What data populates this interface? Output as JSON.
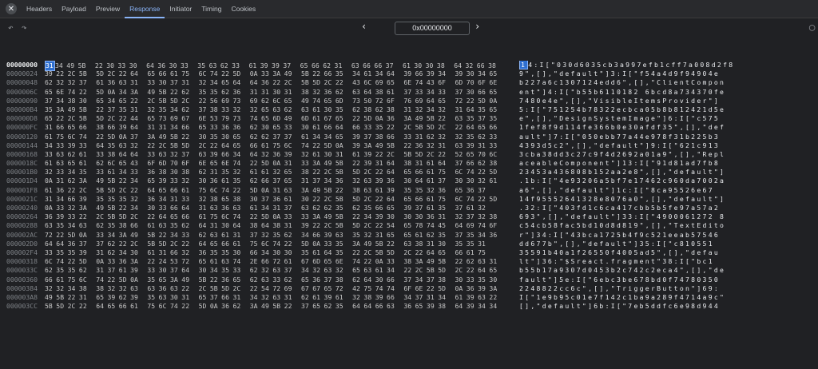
{
  "tabs": [
    {
      "label": "Headers",
      "active": false
    },
    {
      "label": "Payload",
      "active": false
    },
    {
      "label": "Preview",
      "active": false
    },
    {
      "label": "Response",
      "active": true
    },
    {
      "label": "Initiator",
      "active": false
    },
    {
      "label": "Timing",
      "active": false
    },
    {
      "label": "Cookies",
      "active": false
    }
  ],
  "toolbar": {
    "offset_value": "0x00000000"
  },
  "icons": {
    "close": "close-icon",
    "undo": "undo-icon",
    "redo": "redo-icon",
    "prev": "chevron-left-icon",
    "next": "chevron-right-icon",
    "search": "search-icon"
  },
  "colors": {
    "selection": "#2f6fcf",
    "active_tab": "#8ab4f8"
  },
  "rows": [
    {
      "offset": "00000000",
      "hex": "31 34 49 5B 22 30 33 30 64 36 30 33 35 63 62 33 61 39 39 37 65 66 62 31 63 66 66 37 61 30 30 38 64 32 66 38",
      "ascii": "14:I[\"030d6035cb3a997efb1cff7a008d2f8"
    },
    {
      "offset": "00000024",
      "hex": "39 22 2C 5B 5D 2C 22 64 65 66 61 75 6C 74 22 5D 0A 33 3A 49 5B 22 66 35 34 61 34 64 39 66 39 34 39 30 34 65",
      "ascii": "9\",[],\"default\"]3:I[\"f54a4d9f94904e"
    },
    {
      "offset": "00000048",
      "hex": "62 32 32 37 61 36 63 31 33 30 37 31 32 34 65 64 64 36 22 2C 5B 5D 2C 22 43 6C 69 65 6E 74 43 6F 6D 70 6F 6E",
      "ascii": "b227a6c1307124edd6\",[],\"ClientCompon"
    },
    {
      "offset": "0000006C",
      "hex": "65 6E 74 22 5D 0A 34 3A 49 5B 22 62 35 35 62 36 31 31 30 31 38 32 36 62 63 64 38 61 37 33 34 33 37 30 66 65",
      "ascii": "ent\"]4:I[\"b55b6110182 6bcd8a734370fe"
    },
    {
      "offset": "00000090",
      "hex": "37 34 38 30 65 34 65 22 2C 5B 5D 2C 22 56 69 73 69 62 6C 65 49 74 65 6D 73 50 72 6F 76 69 64 65 72 22 5D 0A",
      "ascii": "7480e4e\",[],\"VisibleItemsProvider\"]"
    },
    {
      "offset": "000000B4",
      "hex": "35 3A 49 5B 22 37 35 31 32 35 34 62 37 38 33 32 32 65 63 62 63 61 30 35 62 38 62 38 31 32 34 32 31 64 35 65",
      "ascii": "5:I[\"751254b78322ecbca05b8b812421d5e"
    },
    {
      "offset": "000000D8",
      "hex": "65 22 2C 5B 5D 2C 22 44 65 73 69 67 6E 53 79 73 74 65 6D 49 6D 61 67 65 22 5D 0A 36 3A 49 5B 22 63 35 37 35",
      "ascii": "e\",[],\"DesignSystemImage\"]6:I[\"c575"
    },
    {
      "offset": "000000FC",
      "hex": "31 66 65 66 38 66 39 64 31 31 34 66 65 33 36 36 62 30 65 33 30 61 66 64 66 33 35 22 2C 5B 5D 2C 22 64 65 66",
      "ascii": "1fef8f9d114fe366b0e30afdf35\",[],\"def"
    },
    {
      "offset": "00000120",
      "hex": "61 75 6C 74 22 5D 0A 37 3A 49 5B 22 30 35 30 65 62 62 37 37 61 34 34 65 39 37 38 66 33 31 62 32 32 35 62 33",
      "ascii": "ault\"]7:I[\"050ebb77a44e978f31b225b3"
    },
    {
      "offset": "00000144",
      "hex": "34 33 39 33 64 35 63 32 22 2C 5B 5D 2C 22 64 65 66 61 75 6C 74 22 5D 0A 39 3A 49 5B 22 36 32 31 63 39 31 33",
      "ascii": "4393d5c2\",[],\"default\"]9:I[\"621c913"
    },
    {
      "offset": "00000168",
      "hex": "33 63 62 61 33 38 64 64 33 63 32 37 63 39 66 34 64 32 36 39 32 61 30 31 61 39 22 2C 5B 5D 2C 22 52 65 70 6C",
      "ascii": "3cba38dd3c27c9f4d2692a01a9\",[],\"Repl"
    },
    {
      "offset": "0000018C",
      "hex": "61 63 65 61 62 6C 65 43 6F 6D 70 6F 6E 65 6E 74 22 5D 0A 31 33 3A 49 5B 22 39 31 64 38 31 61 64 37 66 62 38",
      "ascii": "aceableComponent\"]13:I[\"91d81ad7fb8"
    },
    {
      "offset": "000001B0",
      "hex": "32 33 34 35 33 61 34 33 36 38 30 38 62 31 35 32 61 61 32 65 38 22 2C 5B 5D 2C 22 64 65 66 61 75 6C 74 22 5D",
      "ascii": "23453a436808b152aa2e8\",[],\"default\"]"
    },
    {
      "offset": "000001D4",
      "hex": "0A 31 62 3A 49 5B 22 34 65 39 33 32 30 36 61 35 62 66 37 65 31 37 34 36 32 63 39 36 30 64 61 37 30 30 32 61",
      "ascii": ".1b:I[\"4e93206a5bf7e17462c960da7002a"
    },
    {
      "offset": "000001F8",
      "hex": "61 36 22 2C 5B 5D 2C 22 64 65 66 61 75 6C 74 22 5D 0A 31 63 3A 49 5B 22 38 63 61 39 35 35 32 36 65 36 37",
      "ascii": "a6\",[],\"default\"]1c:I[\"8ca95526e67"
    },
    {
      "offset": "0000021C",
      "hex": "31 34 66 39 35 35 35 32 36 34 31 33 32 38 65 38 30 37 36 61 30 22 2C 5B 5D 2C 22 64 65 66 61 75 6C 74 22 5D",
      "ascii": "14f95552641328e8076a0\",[],\"default\"]"
    },
    {
      "offset": "00000240",
      "hex": "0A 33 32 3A 49 5B 22 34 30 33 66 64 31 63 36 63 61 34 31 37 63 62 62 35 62 35 66 65 39 37 61 35 37 61 32",
      "ascii": ".32:I[\"403fd1c6ca417cbb5b5fe97a57a2"
    },
    {
      "offset": "00000264",
      "hex": "36 39 33 22 2C 5B 5D 2C 22 64 65 66 61 75 6C 74 22 5D 0A 33 33 3A 49 5B 22 34 39 30 30 30 36 31 32 37 32 38",
      "ascii": "693\",[],\"default\"]33:I[\"4900061272 8"
    },
    {
      "offset": "00000288",
      "hex": "63 35 34 63 62 35 38 66 61 63 35 62 64 31 30 64 38 64 38 31 39 22 2C 5B 5D 2C 22 54 65 78 74 45 64 69 74 6F",
      "ascii": "c54cb58fac5bd10d8d819\",[],\"TextEdito"
    },
    {
      "offset": "000002AC",
      "hex": "72 22 5D 0A 33 34 3A 49 5B 22 34 33 62 63 61 31 37 32 35 62 34 66 39 63 35 32 31 65 65 61 62 35 37 35 34 36",
      "ascii": "r\"]34:I[\"43bca1725b4f9c521eeab57546"
    },
    {
      "offset": "000002D0",
      "hex": "64 64 36 37 37 62 22 2C 5B 5D 2C 22 64 65 66 61 75 6C 74 22 5D 0A 33 35 3A 49 5B 22 63 38 31 30 35 35 31",
      "ascii": "dd677b\",[],\"default\"]35:I[\"c810551"
    },
    {
      "offset": "000002F4",
      "hex": "33 35 35 39 31 62 34 30 61 31 66 32 36 35 35 30 66 34 30 30 35 61 64 35 22 2C 5B 5D 2C 22 64 65 66 61 75",
      "ascii": "35591b40a1f26550f4005ad5\",[],\"defau"
    },
    {
      "offset": "00000318",
      "hex": "6C 74 22 5D 0A 33 36 3A 22 24 53 72 65 61 63 74 2E 66 72 61 67 6D 65 6E 74 22 0A 33 38 3A 49 5B 22 62 63 31",
      "ascii": "lt\"]36:\"$Sreact.fragment\"38:I[\"bc1"
    },
    {
      "offset": "0000033C",
      "hex": "62 35 35 62 31 37 61 39 33 30 37 64 30 34 35 33 62 32 63 37 34 32 63 32 65 63 61 34 22 2C 5B 5D 2C 22 64 65",
      "ascii": "b55b17a9307d0453b2c742c2eca4\",[],\"de"
    },
    {
      "offset": "00000360",
      "hex": "66 61 75 6C 74 22 5D 0A 35 65 3A 49 5B 22 36 65 62 63 33 62 65 36 37 38 62 64 30 66 37 34 37 38 30 33 35 30",
      "ascii": "fault\"]5e:I[\"6ebc3be678bd0f74780350"
    },
    {
      "offset": "00000384",
      "hex": "32 32 34 38 38 32 32 63 63 36 63 22 2C 5B 5D 2C 22 54 72 69 67 67 65 72 42 75 74 74 6F 6E 22 5D 0A 36 39 3A",
      "ascii": "2248822cc6c\",[],\"TriggerButton\"]69:"
    },
    {
      "offset": "000003A8",
      "hex": "49 5B 22 31 65 39 62 39 35 63 30 31 65 37 66 31 34 32 63 31 62 61 39 61 32 38 39 66 34 37 31 34 61 39 63 22",
      "ascii": "I[\"1e9b95c01e7f142c1ba9a289f4714a9c\""
    },
    {
      "offset": "000003CC",
      "hex": "5B 5D 2C 22 64 65 66 61 75 6C 74 22 5D 0A 36 62 3A 49 5B 22 37 65 62 35 64 64 66 63 36 65 39 38 64 39 34 34",
      "ascii": "[],\"default\"]6b:I[\"7eb5ddfc6e98d944"
    }
  ]
}
